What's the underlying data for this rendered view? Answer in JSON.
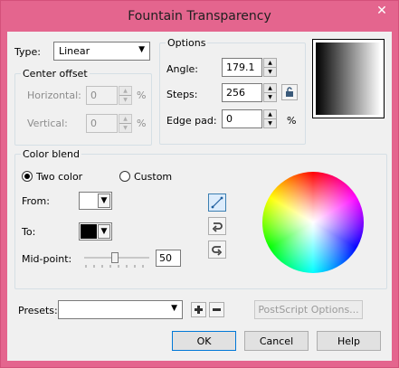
{
  "window": {
    "title": "Fountain Transparency",
    "close_glyph": "✕"
  },
  "type": {
    "label": "Type:",
    "value": "Linear"
  },
  "center_offset": {
    "legend": "Center offset",
    "horizontal_label": "Horizontal:",
    "horizontal_value": "0",
    "vertical_label": "Vertical:",
    "vertical_value": "0",
    "unit": "%"
  },
  "options": {
    "legend": "Options",
    "angle_label": "Angle:",
    "angle_value": "179.1",
    "steps_label": "Steps:",
    "steps_value": "256",
    "edgepad_label": "Edge pad:",
    "edgepad_value": "0",
    "unit": "%"
  },
  "color_blend": {
    "legend": "Color blend",
    "two_color_label": "Two color",
    "custom_label": "Custom",
    "selected_mode": "Two color",
    "from_label": "From:",
    "from_color": "#ffffff",
    "to_label": "To:",
    "to_color": "#000000",
    "midpoint_label": "Mid-point:",
    "midpoint_value": "50"
  },
  "presets": {
    "label": "Presets:",
    "value": "",
    "postscript_label": "PostScript Options..."
  },
  "buttons": {
    "ok": "OK",
    "cancel": "Cancel",
    "help": "Help"
  },
  "colors": {
    "accent": "#e4658e",
    "default_border": "#0078d7"
  }
}
